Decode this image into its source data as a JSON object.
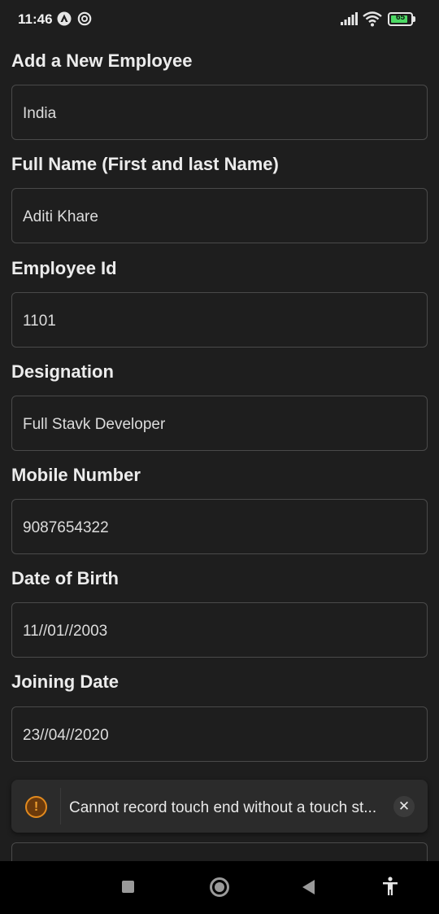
{
  "status_bar": {
    "time": "11:46",
    "battery_level": "65",
    "icons": [
      "android-auto-icon",
      "data-saver-icon",
      "signal-icon",
      "wifi-icon",
      "battery-icon"
    ]
  },
  "form": {
    "title": "Add a New Employee",
    "fields": [
      {
        "label": "",
        "value": "India"
      },
      {
        "label": "Full Name (First and last Name)",
        "value": "Aditi Khare"
      },
      {
        "label": "Employee Id",
        "value": "1101"
      },
      {
        "label": "Designation",
        "value": "Full Stavk Developer"
      },
      {
        "label": "Mobile Number",
        "value": "9087654322"
      },
      {
        "label": "Date of Birth",
        "value": "11//01//2003"
      },
      {
        "label": "Joining Date",
        "value": "23//04//2020"
      }
    ]
  },
  "toast": {
    "message": "Cannot record touch end without a touch st...",
    "icon": "warning-icon",
    "close_icon": "close-icon"
  },
  "colors": {
    "background": "#1e1e1e",
    "field_border": "#4a4a4a",
    "toast_background": "#2b2b2b",
    "warning_accent": "#e28a1e",
    "battery_fill": "#4cd964",
    "nav_bar": "#000000"
  }
}
